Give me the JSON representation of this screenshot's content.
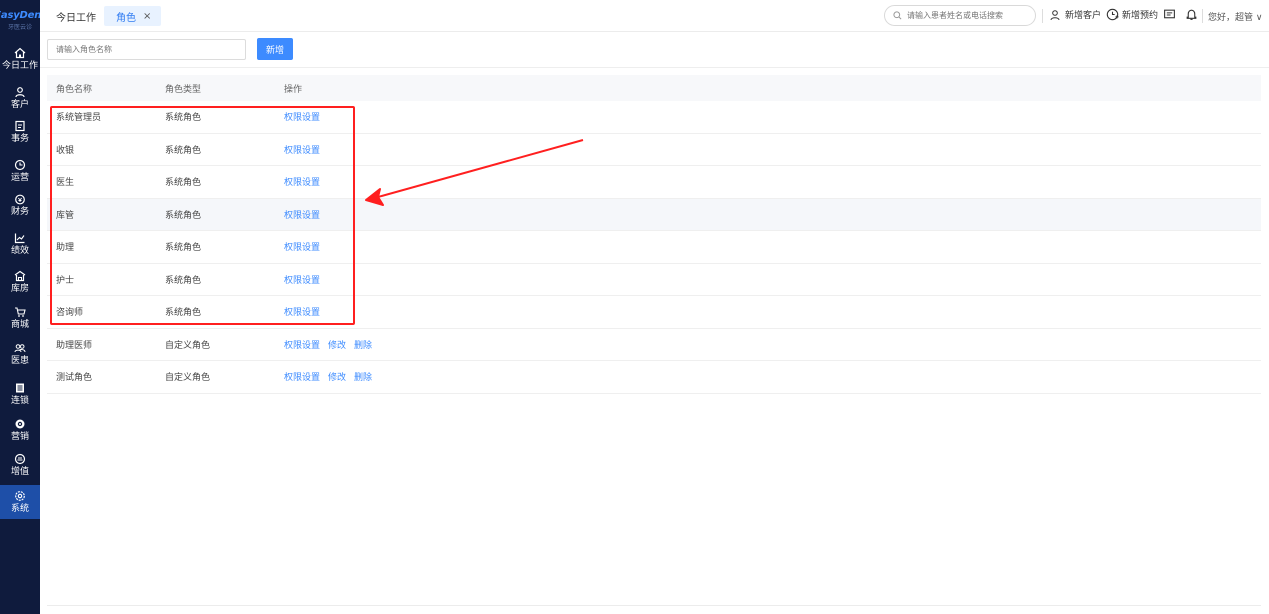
{
  "brand": {
    "name": "EasyDent",
    "sub": "牙医云诊"
  },
  "sidebar": {
    "items": [
      {
        "label": "今日工作",
        "icon": "home-icon",
        "active": false
      },
      {
        "label": "客户",
        "icon": "user-icon",
        "active": false
      },
      {
        "label": "事务",
        "icon": "task-icon",
        "active": false
      },
      {
        "label": "运营",
        "icon": "clock-icon",
        "active": false
      },
      {
        "label": "财务",
        "icon": "wallet-icon",
        "active": false
      },
      {
        "label": "绩效",
        "icon": "chart-icon",
        "active": false
      },
      {
        "label": "库房",
        "icon": "warehouse-icon",
        "active": false
      },
      {
        "label": "商城",
        "icon": "cart-icon",
        "active": false
      },
      {
        "label": "医患",
        "icon": "people-icon",
        "active": false
      },
      {
        "label": "连锁",
        "icon": "chain-icon",
        "active": false
      },
      {
        "label": "营销",
        "icon": "marketing-icon",
        "active": false
      },
      {
        "label": "增值",
        "icon": "addon-icon",
        "active": false
      },
      {
        "label": "系统",
        "icon": "settings-icon",
        "active": true
      }
    ]
  },
  "topbar": {
    "tab_today": "今日工作",
    "tab_active": "角色",
    "tab_close": "×",
    "search_placeholder": "请输入患者姓名或电话搜索",
    "new_customer": "新增客户",
    "new_appointment": "新增预约",
    "greeting": "您好，超管 ∨"
  },
  "filter": {
    "placeholder": "请输入角色名称",
    "add_button": "新增"
  },
  "table": {
    "headers": [
      "角色名称",
      "角色类型",
      "操作"
    ],
    "rows": [
      {
        "name": "系统管理员",
        "type": "系统角色",
        "actions": [
          "权限设置"
        ]
      },
      {
        "name": "收银",
        "type": "系统角色",
        "actions": [
          "权限设置"
        ]
      },
      {
        "name": "医生",
        "type": "系统角色",
        "actions": [
          "权限设置"
        ]
      },
      {
        "name": "库管",
        "type": "系统角色",
        "actions": [
          "权限设置"
        ]
      },
      {
        "name": "助理",
        "type": "系统角色",
        "actions": [
          "权限设置"
        ]
      },
      {
        "name": "护士",
        "type": "系统角色",
        "actions": [
          "权限设置"
        ]
      },
      {
        "name": "咨询师",
        "type": "系统角色",
        "actions": [
          "权限设置"
        ]
      },
      {
        "name": "助理医师",
        "type": "自定义角色",
        "actions": [
          "权限设置",
          "修改",
          "删除"
        ]
      },
      {
        "name": "测试角色",
        "type": "自定义角色",
        "actions": [
          "权限设置",
          "修改",
          "删除"
        ]
      }
    ]
  },
  "colors": {
    "sidebar_bg": "#0f1b3d",
    "accent": "#3d8bff",
    "annotation": "#ff1f1f"
  }
}
